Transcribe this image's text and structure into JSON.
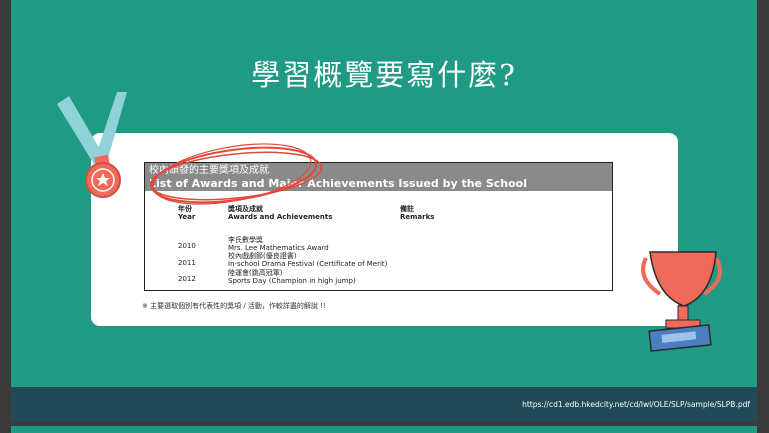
{
  "slide": {
    "title": "學習概覽要寫什麼?",
    "footer_url": "https://cd1.edb.hkedcity.net/cd/lwl/OLE/SLP/sample/SLPB.pdf",
    "note": "※ 主要選取個別有代表性的獎項 / 活動，作較詳盡的解說 !!"
  },
  "table": {
    "title_zh": "校內頒發的主要獎項及成就",
    "title_en": "List of Awards and Major Achievements Issued by the School",
    "col_year_zh": "年份",
    "col_year_en": "Year",
    "col_awards_zh": "獎項及成就",
    "col_awards_en": "Awards and Achievements",
    "col_remarks_zh": "備註",
    "col_remarks_en": "Remarks",
    "rows": [
      {
        "year": "2010",
        "zh": "李氏數學獎",
        "en": "Mrs. Lee Mathematics Award"
      },
      {
        "year": "2011",
        "zh": "校內戲劇節(優良證書)",
        "en": "In-school Drama Festival (Certificate of Merit)"
      },
      {
        "year": "2012",
        "zh": "陸運會(跳高冠軍)",
        "en": "Sports Day (Champion in high jump)"
      }
    ]
  },
  "colors": {
    "background": "#1f9a84",
    "footer": "#1f4a56",
    "highlight_circle": "#e04a3a",
    "medal_ribbon": "#8fd3d9",
    "medal": "#ef6a5a",
    "trophy": "#ef6a5a",
    "trophy_base": "#4a7fbf"
  },
  "icons": [
    "medal-icon",
    "trophy-icon",
    "star-icon"
  ]
}
